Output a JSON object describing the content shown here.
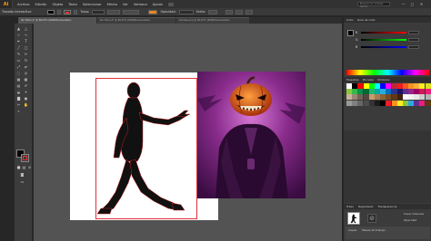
{
  "app": {
    "logo": "Ai"
  },
  "menu": [
    "Archivo",
    "Edición",
    "Objeto",
    "Texto",
    "Seleccionar",
    "Efecto",
    "Ver",
    "Ventana",
    "Ayuda"
  ],
  "search": {
    "value": "Buscar en Adobe Stock"
  },
  "window_buttons": [
    "—",
    "□",
    "✕"
  ],
  "controlbar": {
    "selection_label": "Trazado interactivo",
    "stroke_label": "Trazo:",
    "opacity_label": "Opacidad:",
    "style_label": "Estilo:"
  },
  "tabs": [
    {
      "label": "Sin título-1* @ 66,67% (RGB/Previsualizar)",
      "active": true
    },
    {
      "label": "Sin título-2* @ 66,67% (RGB/Previsualizar)",
      "active": false
    },
    {
      "label": "Zombie.png @ 66,67% (RGB/Previsualizar)",
      "active": false
    }
  ],
  "tools": [
    "selection-tool",
    "direct-selection-tool",
    "magic-wand-tool",
    "lasso-tool",
    "pen-tool",
    "type-tool",
    "line-tool",
    "rectangle-tool",
    "paintbrush-tool",
    "pencil-tool",
    "eraser-tool",
    "rotate-tool",
    "scale-tool",
    "width-tool",
    "free-transform-tool",
    "shape-builder-tool",
    "perspective-grid-tool",
    "mesh-tool",
    "gradient-tool",
    "eyedropper-tool",
    "blend-tool",
    "symbol-sprayer-tool",
    "column-graph-tool",
    "artboard-tool",
    "slice-tool",
    "hand-tool",
    "zoom-tool"
  ],
  "panels": {
    "color_tabs": [
      "Color",
      "Guía de color"
    ],
    "channels": [
      "R",
      "G",
      "B"
    ],
    "swatches_tabs": [
      "Muestras",
      "Pinceles",
      "Símbolos"
    ],
    "bottom_tabs": [
      "Capas",
      "Mesas de trabajo"
    ],
    "appearance_tabs": [
      "Trazo",
      "Degradado",
      "Transparencia"
    ],
    "layer_button_labels": [
      "Crear máscara",
      "Opacidad"
    ]
  },
  "colors": {
    "selection": "#e0303a",
    "accent_orange": "#e8871e",
    "photo_purple": "#8a2c8c",
    "pumpkin": "#e35a12"
  },
  "swatches": [
    "#ffffff",
    "#000000",
    "#ff0000",
    "#ffff00",
    "#00ff00",
    "#00ffff",
    "#0000ff",
    "#ff00ff",
    "#c1272d",
    "#ed1c24",
    "#f15a24",
    "#f7931e",
    "#fbb03b",
    "#fcee21",
    "#d9e021",
    "#8cc63f",
    "#39b54a",
    "#009245",
    "#006837",
    "#22b573",
    "#00a99d",
    "#29abe2",
    "#0071bc",
    "#2e3192",
    "#1b1464",
    "#662d91",
    "#93278f",
    "#9e005d",
    "#d4145a",
    "#ed1e79",
    "#c7b299",
    "#998675",
    "#736357",
    "#534741",
    "#c69c6d",
    "#a67c52",
    "#8c6239",
    "#754c24",
    "#603813",
    "#42210b",
    "#ffffff",
    "#f2f2f2",
    "#e6e6e6",
    "#cccccc",
    "#b3b3b3",
    "#999999",
    "#808080",
    "#666666",
    "#4d4d4d",
    "#333333",
    "#1a1a1a",
    "#000000",
    "#ed1c24",
    "#f7931e",
    "#fcee21",
    "#8cc63f",
    "#29abe2",
    "#662d91",
    "#ed1e79",
    "#603813"
  ]
}
